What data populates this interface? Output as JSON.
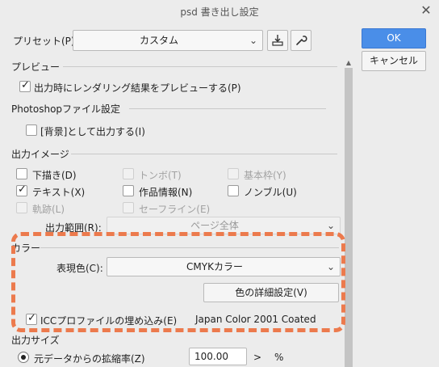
{
  "window": {
    "title": "psd 書き出し設定",
    "close_glyph": "✕"
  },
  "preset": {
    "label": "プリセット(P):",
    "value": "カスタム"
  },
  "buttons": {
    "ok": "OK",
    "cancel": "キャンセル",
    "color_detail": "色の詳細設定(V)"
  },
  "preview": {
    "section": "プレビュー",
    "render_preview": {
      "label": "出力時にレンダリング結果をプレビューする(P)",
      "checked": true
    }
  },
  "photoshop": {
    "section": "Photoshopファイル設定",
    "bg_output": {
      "label": "[背景]として出力する(I)",
      "checked": false
    }
  },
  "output_image": {
    "section": "出力イメージ",
    "items": [
      {
        "label": "下描き(D)",
        "checked": false,
        "enabled": true
      },
      {
        "label": "トンボ(T)",
        "checked": false,
        "enabled": false
      },
      {
        "label": "基本枠(Y)",
        "checked": false,
        "enabled": false
      },
      {
        "label": "テキスト(X)",
        "checked": true,
        "enabled": true
      },
      {
        "label": "作品情報(N)",
        "checked": false,
        "enabled": true
      },
      {
        "label": "ノンブル(U)",
        "checked": false,
        "enabled": true
      },
      {
        "label": "軌跡(L)",
        "checked": false,
        "enabled": false
      },
      {
        "label": "セーフライン(E)",
        "checked": false,
        "enabled": false
      }
    ],
    "range": {
      "label": "出力範囲(R):",
      "value": "ページ全体"
    }
  },
  "color": {
    "section": "カラー",
    "expression": {
      "label": "表現色(C):",
      "value": "CMYKカラー"
    },
    "icc_embed": {
      "label": "ICCプロファイルの埋め込み(E)",
      "checked": true
    },
    "icc_profile": "Japan Color 2001 Coated"
  },
  "size": {
    "section": "出力サイズ",
    "scale": {
      "label": "元データからの拡縮率(Z)",
      "value": "100.00",
      "unit": "%",
      "arrow": ">"
    }
  },
  "icons": {
    "dropdown": "chevron-down-icon",
    "save_preset": "save-preset-icon",
    "settings": "wrench-icon"
  },
  "colors": {
    "accent": "#4a8ee8",
    "highlight": "#ec7a4d"
  }
}
